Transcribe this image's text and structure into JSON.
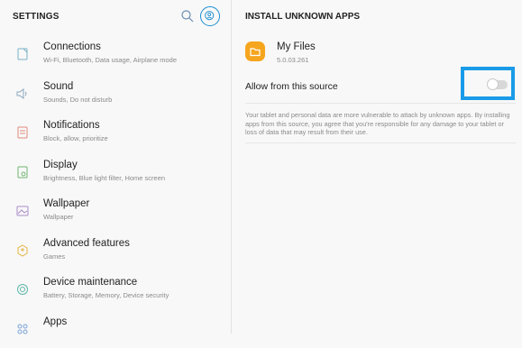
{
  "settings": {
    "title": "SETTINGS",
    "menu": [
      {
        "title": "Connections",
        "subtitle": "Wi-Fi, Bluetooth, Data usage, Airplane mode",
        "icon": "connections-icon"
      },
      {
        "title": "Sound",
        "subtitle": "Sounds, Do not disturb",
        "icon": "sound-icon"
      },
      {
        "title": "Notifications",
        "subtitle": "Block, allow, prioritize",
        "icon": "notifications-icon"
      },
      {
        "title": "Display",
        "subtitle": "Brightness, Blue light filter, Home screen",
        "icon": "display-icon"
      },
      {
        "title": "Wallpaper",
        "subtitle": "Wallpaper",
        "icon": "wallpaper-icon"
      },
      {
        "title": "Advanced features",
        "subtitle": "Games",
        "icon": "advanced-features-icon"
      },
      {
        "title": "Device maintenance",
        "subtitle": "Battery, Storage, Memory, Device security",
        "icon": "device-maintenance-icon"
      },
      {
        "title": "Apps",
        "subtitle": "",
        "icon": "apps-icon"
      }
    ]
  },
  "install": {
    "title": "INSTALL UNKNOWN APPS",
    "app_name": "My Files",
    "app_version": "5.0.03.261",
    "allow_label": "Allow from this source",
    "allow_enabled": false,
    "warning": "Your tablet and personal data are more vulnerable to attack by unknown apps. By installing apps from this source, you agree that you're responsible for any damage to your tablet or loss of data that may result from their use."
  },
  "colors": {
    "accent": "#1b8fd1",
    "highlight": "#1a9be8",
    "icon_tint": "#c9b15a",
    "folder": "#f6a51e"
  }
}
